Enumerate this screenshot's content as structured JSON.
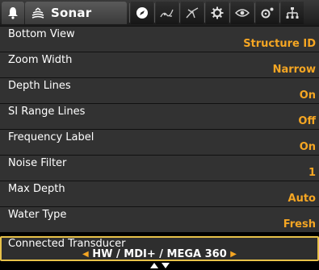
{
  "tabs": {
    "active_label": "Sonar"
  },
  "settings": [
    {
      "name": "Bottom View",
      "value": "Structure ID"
    },
    {
      "name": "Zoom Width",
      "value": "Narrow"
    },
    {
      "name": "Depth Lines",
      "value": "On"
    },
    {
      "name": "SI Range Lines",
      "value": "Off"
    },
    {
      "name": "Frequency Label",
      "value": "On"
    },
    {
      "name": "Noise Filter",
      "value": "1"
    },
    {
      "name": "Max Depth",
      "value": "Auto"
    },
    {
      "name": "Water Type",
      "value": "Fresh"
    }
  ],
  "transducer": {
    "label": "Connected Transducer",
    "value": "HW / MDI+ / MEGA 360"
  },
  "colors": {
    "value_accent": "#f5a623",
    "selection_border": "#e8c24a"
  },
  "icons": [
    "bell-icon",
    "sonar-icon",
    "navigation-icon",
    "fishing-icon",
    "radar-icon",
    "gear-icon",
    "eye-icon",
    "accessories-icon",
    "network-icon",
    "scroll-arrows-icon"
  ]
}
